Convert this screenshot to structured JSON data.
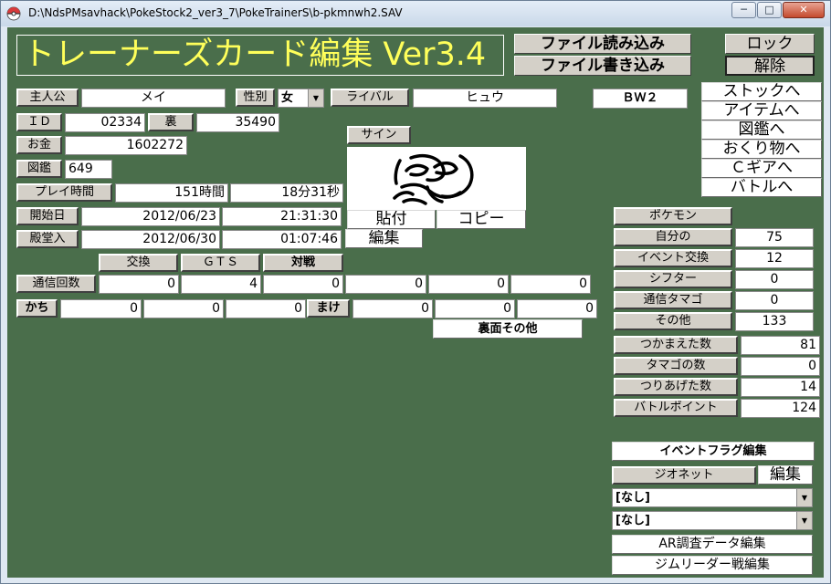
{
  "window": {
    "title": "D:\\NdsPMsavhack\\PokeStock2_ver3_7\\PokeTrainerS\\b-pkmnwh2.SAV",
    "min": "─",
    "max": "□",
    "close": "✕"
  },
  "app_title": "トレーナーズカード編集 Ver3.4",
  "file": {
    "load": "ファイル読み込み",
    "write": "ファイル書き込み"
  },
  "lock": {
    "lock": "ロック",
    "unlock": "解除"
  },
  "game_version": "ＢＷ２",
  "nav": [
    "ストックへ",
    "アイテムへ",
    "図鑑へ",
    "おくり物へ",
    "Ｃギアへ",
    "バトルへ"
  ],
  "trainer": {
    "name_label": "主人公",
    "name": "メイ",
    "gender_label": "性別",
    "gender": "女",
    "rival_label": "ライバル",
    "rival": "ヒュウ",
    "id_label": "ＩＤ",
    "id": "02334",
    "sid_label": "裏",
    "sid": "35490",
    "money_label": "お金",
    "money": "1602272",
    "dex_label": "図鑑",
    "dex": "649",
    "playtime_label": "プレイ時間",
    "play_hours": "151時間",
    "play_minsec": "18分31秒",
    "start_label": "開始日",
    "start_date": "2012/06/23",
    "start_time": "21:31:30",
    "hof_label": "殿堂入",
    "hof_date": "2012/06/30",
    "hof_time": "01:07:46"
  },
  "sign": {
    "label": "サイン",
    "paste": "貼付",
    "copy": "コピー",
    "edit": "編集"
  },
  "comm": {
    "trade_header": "交換",
    "gts_header": "ＧＴＳ",
    "battle_header": "対戦",
    "count_label": "通信回数",
    "counts": [
      "0",
      "4",
      "0",
      "0",
      "0",
      "0"
    ],
    "win_label": "かち",
    "wins": [
      "0",
      "0",
      "0"
    ],
    "lose_label": "まけ",
    "losses": [
      "0",
      "0",
      "0"
    ],
    "back_side": "裏面その他"
  },
  "pokemon_stats": {
    "header": "ポケモン",
    "rows": [
      {
        "label": "自分の",
        "value": "75"
      },
      {
        "label": "イベント交換",
        "value": "12"
      },
      {
        "label": "シフター",
        "value": "0"
      },
      {
        "label": "通信タマゴ",
        "value": "0"
      },
      {
        "label": "その他",
        "value": "133"
      }
    ]
  },
  "records": [
    {
      "label": "つかまえた数",
      "value": "81"
    },
    {
      "label": "タマゴの数",
      "value": "0"
    },
    {
      "label": "つりあげた数",
      "value": "14"
    },
    {
      "label": "バトルポイント",
      "value": "124"
    }
  ],
  "event": {
    "flag_edit": "イベントフラグ編集",
    "geonet": "ジオネット",
    "geonet_edit": "編集",
    "select1": "[なし]",
    "select2": "[なし]",
    "ar_edit": "AR調査データ編集",
    "gym_edit": "ジムリーダー戦編集"
  }
}
